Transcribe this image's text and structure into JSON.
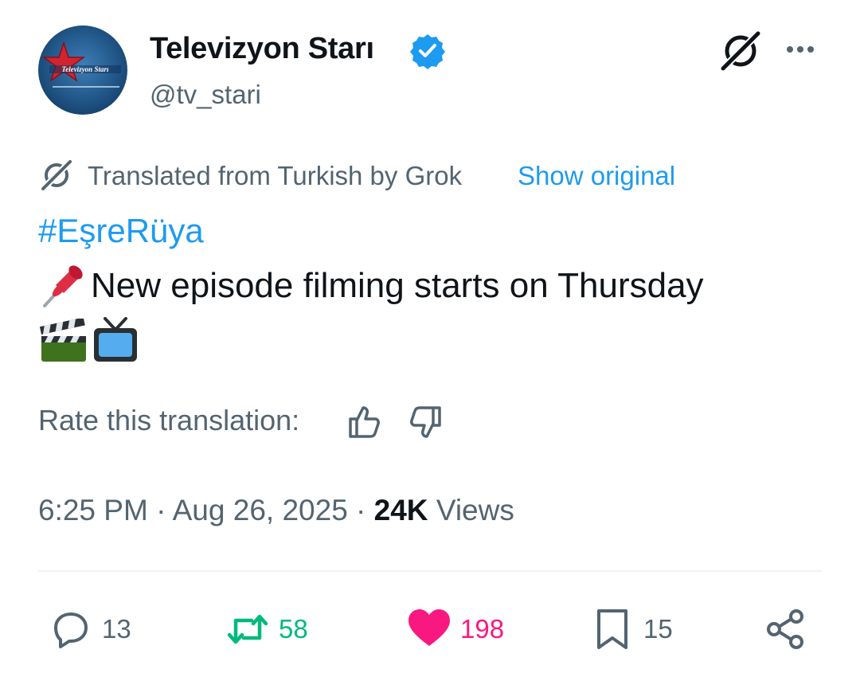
{
  "author": {
    "display_name": "Televizyon Starı",
    "handle": "@tv_stari",
    "avatar_text": "Televizyon Starı",
    "verified": true
  },
  "translation": {
    "text": "Translated from Turkish by Grok",
    "show_original": "Show original"
  },
  "tweet": {
    "hashtag": "#EşreRüya",
    "text": "New episode filming starts on Thursday",
    "emojis": [
      "pushpin",
      "clapper-board",
      "television"
    ]
  },
  "rate": {
    "label": "Rate this translation:"
  },
  "meta": {
    "time_date": "6:25 PM · Aug 26, 2025 · ",
    "views_count": "24K",
    "views_label": " Views"
  },
  "actions": {
    "replies": "13",
    "reposts": "58",
    "likes": "198",
    "bookmarks": "15"
  },
  "colors": {
    "accent": "#1d9bf0",
    "muted": "#536471",
    "repost": "#00ba7c",
    "like": "#f91880"
  }
}
